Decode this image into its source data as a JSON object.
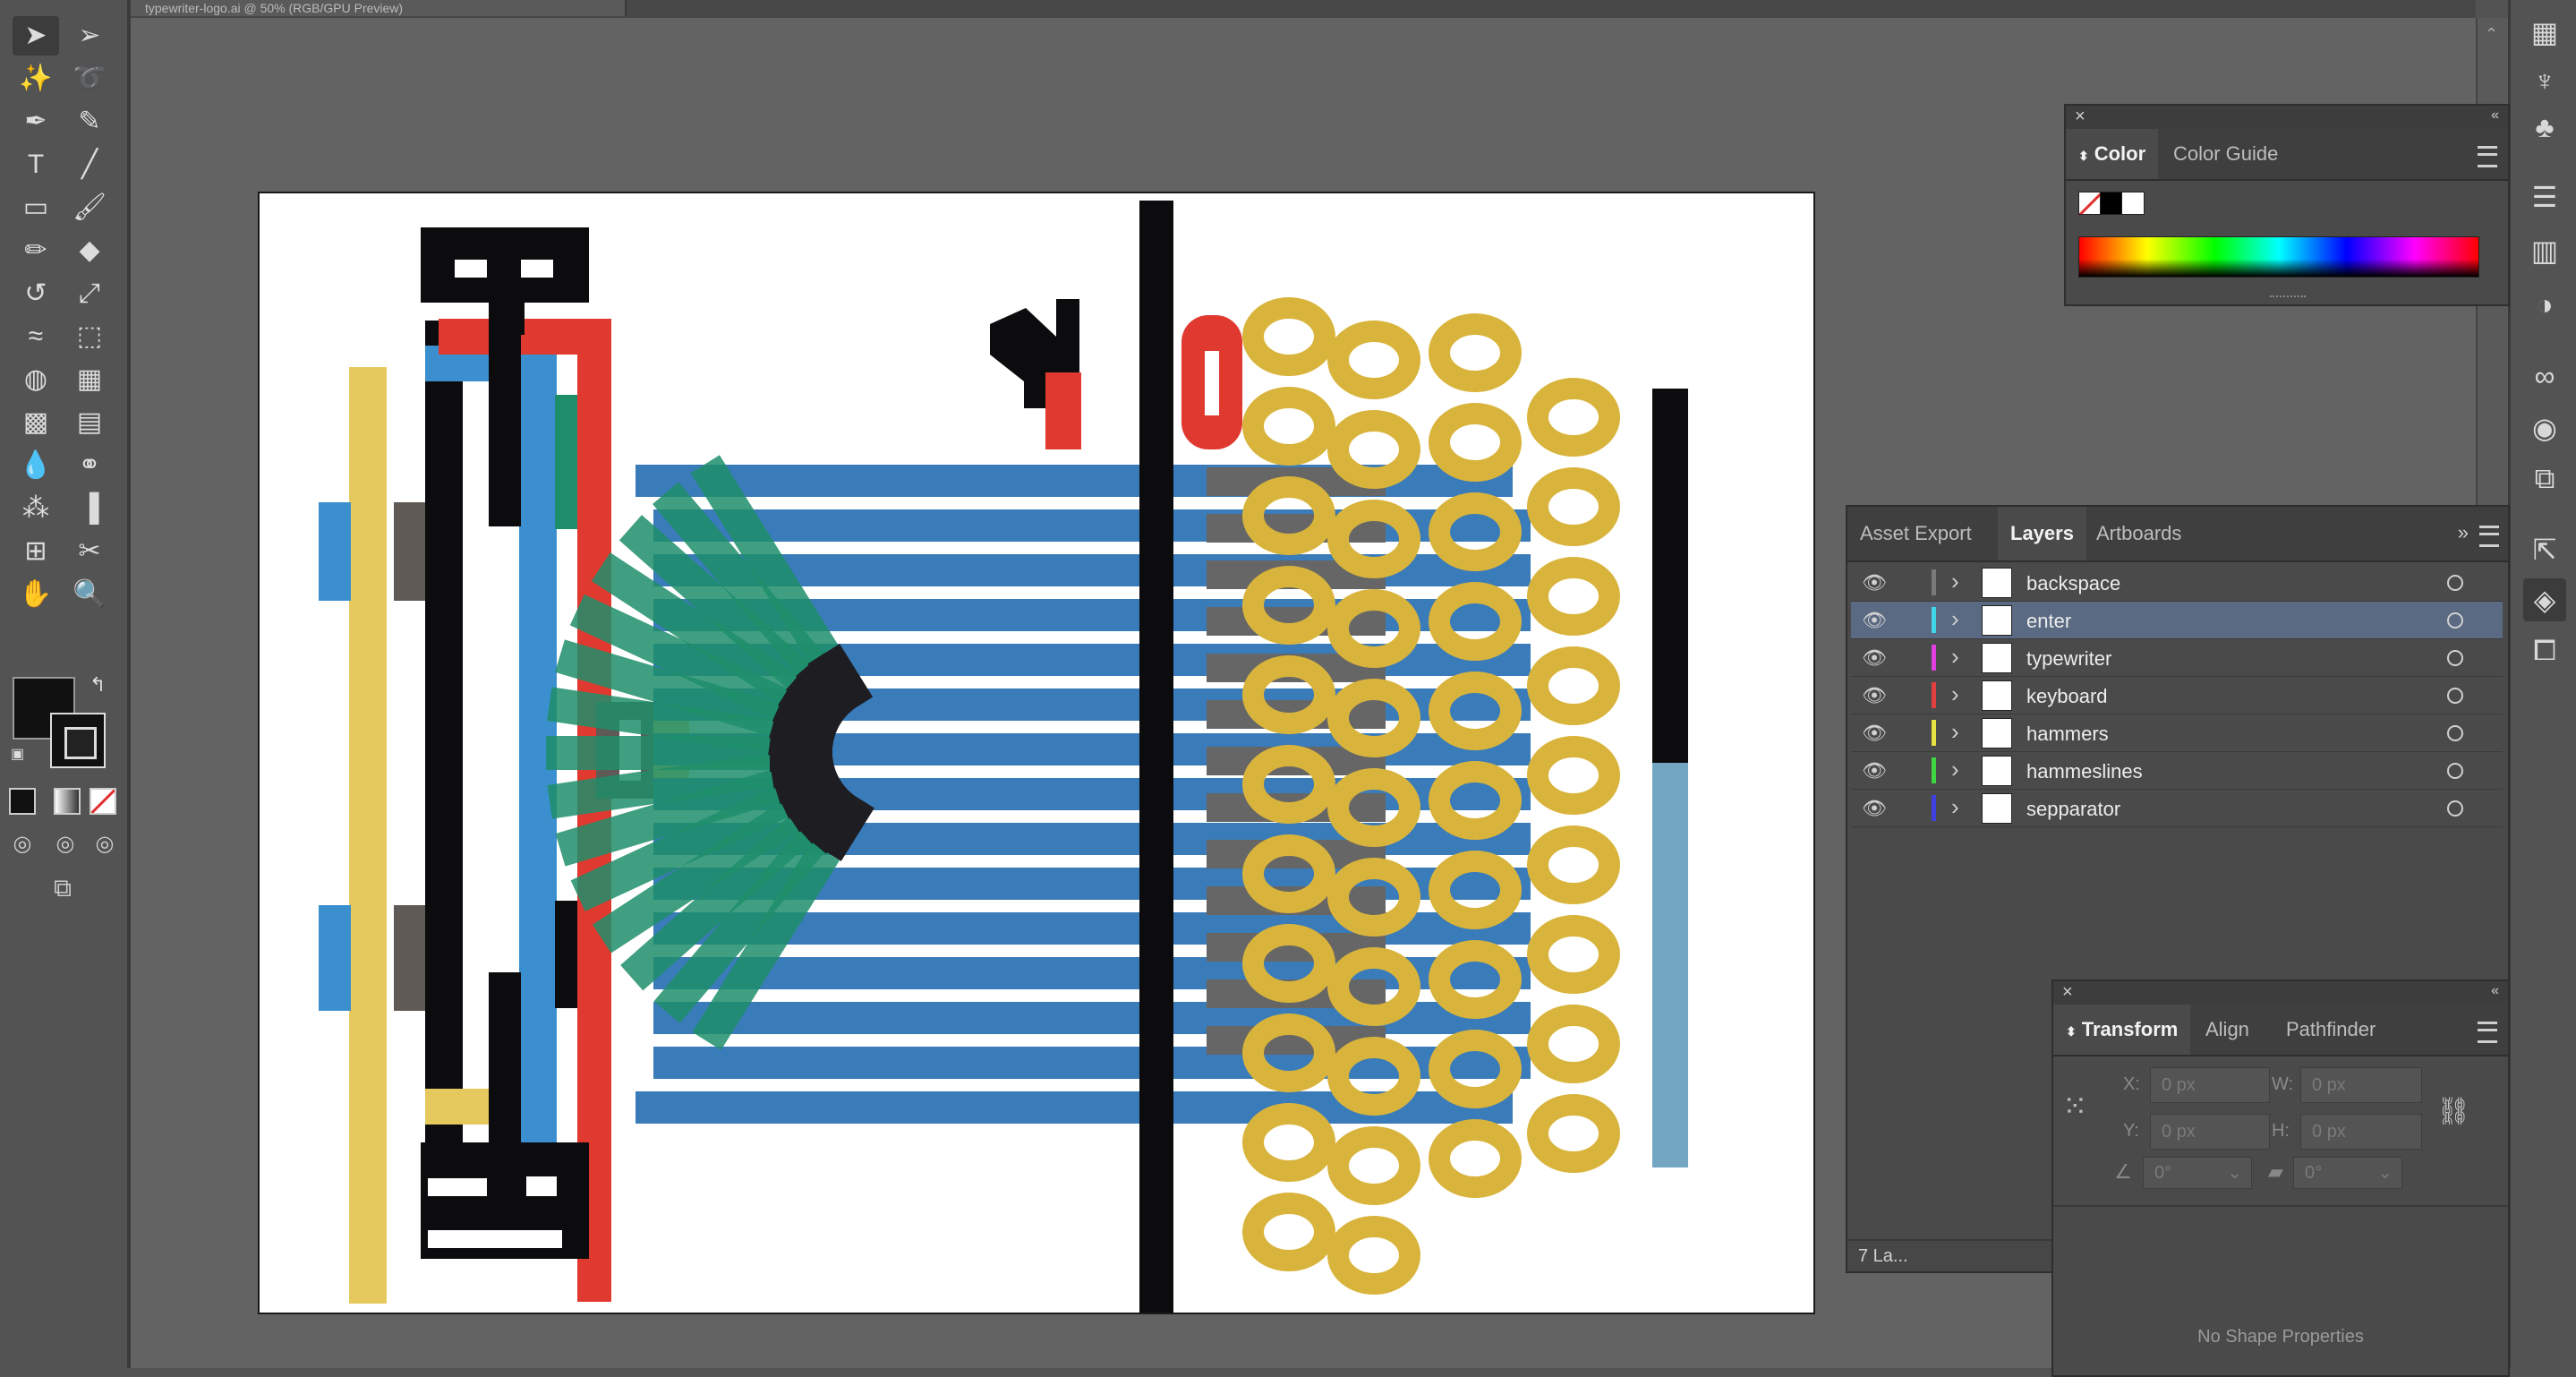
{
  "document": {
    "tab_title": "typewriter-logo.ai @ 50% (RGB/GPU Preview)"
  },
  "toolbar": {
    "tools": [
      {
        "name": "selection-tool",
        "icon": "selection-arrow-icon",
        "glyph": "➤",
        "selected": true
      },
      {
        "name": "direct-selection-tool",
        "icon": "direct-selection-icon",
        "glyph": "➢"
      },
      {
        "name": "magic-wand-tool",
        "icon": "magic-wand-icon",
        "glyph": "✨"
      },
      {
        "name": "lasso-tool",
        "icon": "lasso-icon",
        "glyph": "➰"
      },
      {
        "name": "pen-tool",
        "icon": "pen-icon",
        "glyph": "✒"
      },
      {
        "name": "curvature-tool",
        "icon": "curvature-icon",
        "glyph": "✎"
      },
      {
        "name": "type-tool",
        "icon": "type-icon",
        "glyph": "T"
      },
      {
        "name": "line-tool",
        "icon": "line-icon",
        "glyph": "╱"
      },
      {
        "name": "rectangle-tool",
        "icon": "rectangle-icon",
        "glyph": "▭"
      },
      {
        "name": "paintbrush-tool",
        "icon": "paintbrush-icon",
        "glyph": "🖌"
      },
      {
        "name": "pencil-tool",
        "icon": "pencil-icon",
        "glyph": "✏"
      },
      {
        "name": "eraser-tool",
        "icon": "eraser-icon",
        "glyph": "◆"
      },
      {
        "name": "rotate-tool",
        "icon": "rotate-icon",
        "glyph": "↺"
      },
      {
        "name": "scale-tool",
        "icon": "scale-icon",
        "glyph": "⤢"
      },
      {
        "name": "warp-tool",
        "icon": "warp-icon",
        "glyph": "≈"
      },
      {
        "name": "free-transform-tool",
        "icon": "free-transform-icon",
        "glyph": "⬚"
      },
      {
        "name": "shape-builder-tool",
        "icon": "shape-builder-icon",
        "glyph": "◍"
      },
      {
        "name": "perspective-grid-tool",
        "icon": "perspective-grid-icon",
        "glyph": "▦"
      },
      {
        "name": "mesh-tool",
        "icon": "mesh-icon",
        "glyph": "▩"
      },
      {
        "name": "gradient-tool",
        "icon": "gradient-icon",
        "glyph": "▤"
      },
      {
        "name": "eyedropper-tool",
        "icon": "eyedropper-icon",
        "glyph": "💧"
      },
      {
        "name": "blend-tool",
        "icon": "blend-icon",
        "glyph": "⚭"
      },
      {
        "name": "symbol-sprayer-tool",
        "icon": "symbol-sprayer-icon",
        "glyph": "⁂"
      },
      {
        "name": "column-graph-tool",
        "icon": "column-graph-icon",
        "glyph": "▐"
      },
      {
        "name": "artboard-tool",
        "icon": "artboard-icon",
        "glyph": "⊞"
      },
      {
        "name": "slice-tool",
        "icon": "slice-icon",
        "glyph": "✂"
      },
      {
        "name": "hand-tool",
        "icon": "hand-icon",
        "glyph": "✋"
      },
      {
        "name": "zoom-tool",
        "icon": "zoom-icon",
        "glyph": "🔍"
      }
    ]
  },
  "color_panel": {
    "tabs": [
      "Color",
      "Color Guide"
    ],
    "active_tab": "Color"
  },
  "layers_panel": {
    "tabs": [
      "Asset Export",
      "Layers",
      "Artboards"
    ],
    "active_tab": "Layers",
    "footer": "7 La...",
    "layers": [
      {
        "name": "backspace",
        "color": "#7a7a7a",
        "selected": false
      },
      {
        "name": "enter",
        "color": "#3fd6e6",
        "selected": true
      },
      {
        "name": "typewriter",
        "color": "#e040e0",
        "selected": false
      },
      {
        "name": "keyboard",
        "color": "#e04040",
        "selected": false
      },
      {
        "name": "hammers",
        "color": "#e6e040",
        "selected": false
      },
      {
        "name": "hammeslines",
        "color": "#40d640",
        "selected": false
      },
      {
        "name": "sepparator",
        "color": "#4040e0",
        "selected": false
      }
    ]
  },
  "transform_panel": {
    "tabs": [
      "Transform",
      "Align",
      "Pathfinder"
    ],
    "active_tab": "Transform",
    "x_label": "X:",
    "x_value": "0 px",
    "y_label": "Y:",
    "y_value": "0 px",
    "w_label": "W:",
    "w_value": "0 px",
    "h_label": "H:",
    "h_value": "0 px",
    "angle_value": "0°",
    "shear_value": "0°",
    "empty_message": "No Shape Properties"
  },
  "colors": {
    "black": "#0c0c0e",
    "red": "#e03a30",
    "blue": "#3b8fcf",
    "yellow": "#e6c95e",
    "green": "#1e8e6a",
    "gold": "#d9b43c",
    "gray": "#5f5a55",
    "steel": "#73a6c2",
    "bar_blue": "#2f74b5"
  }
}
